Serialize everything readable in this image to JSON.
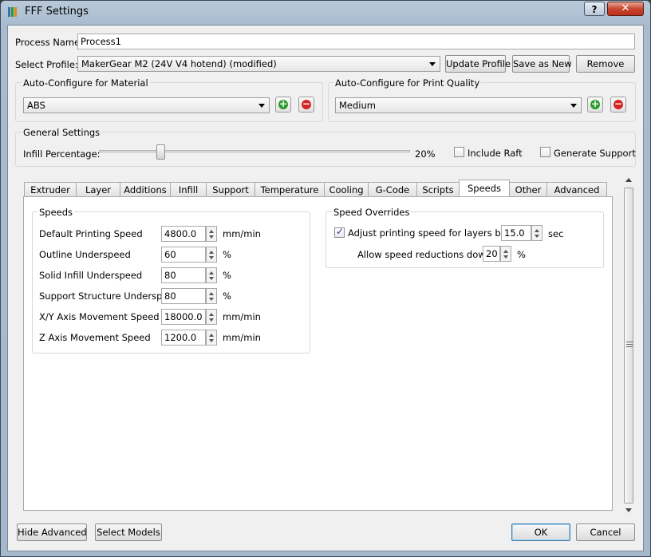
{
  "window": {
    "title": "FFF Settings",
    "help_label": "?",
    "close_label": "✕"
  },
  "process": {
    "label": "Process Name:",
    "value": "Process1"
  },
  "profile": {
    "label": "Select Profile:",
    "selected": "MakerGear M2 (24V V4 hotend) (modified)",
    "update_label": "Update Profile",
    "save_label": "Save as New",
    "remove_label": "Remove"
  },
  "material": {
    "title": "Auto-Configure for Material",
    "selected": "ABS"
  },
  "quality": {
    "title": "Auto-Configure for Print Quality",
    "selected": "Medium"
  },
  "general": {
    "title": "General Settings",
    "infill_label": "Infill Percentage:",
    "infill_value_text": "20%",
    "infill_percent": 20,
    "raft_label": "Include Raft",
    "raft_checked": false,
    "support_label": "Generate Support",
    "support_checked": false
  },
  "tabs": [
    {
      "label": "Extruder"
    },
    {
      "label": "Layer"
    },
    {
      "label": "Additions"
    },
    {
      "label": "Infill"
    },
    {
      "label": "Support"
    },
    {
      "label": "Temperature"
    },
    {
      "label": "Cooling"
    },
    {
      "label": "G-Code"
    },
    {
      "label": "Scripts"
    },
    {
      "label": "Speeds"
    },
    {
      "label": "Other"
    },
    {
      "label": "Advanced"
    }
  ],
  "active_tab": "Speeds",
  "speeds": {
    "title": "Speeds",
    "rows": [
      {
        "label": "Default Printing Speed",
        "value": "4800.0",
        "unit": "mm/min"
      },
      {
        "label": "Outline Underspeed",
        "value": "60",
        "unit": "%"
      },
      {
        "label": "Solid Infill Underspeed",
        "value": "80",
        "unit": "%"
      },
      {
        "label": "Support Structure Underspeed",
        "value": "80",
        "unit": "%"
      },
      {
        "label": "X/Y Axis Movement Speed",
        "value": "18000.0",
        "unit": "mm/min"
      },
      {
        "label": "Z Axis Movement Speed",
        "value": "1200.0",
        "unit": "mm/min"
      }
    ]
  },
  "overrides": {
    "title": "Speed Overrides",
    "adjust_label": "Adjust printing speed for layers below",
    "adjust_checked": true,
    "adjust_value": "15.0",
    "adjust_unit": "sec",
    "allow_label": "Allow speed reductions down to",
    "allow_value": "20",
    "allow_unit": "%"
  },
  "footer": {
    "hide_advanced_label": "Hide Advanced",
    "select_models_label": "Select Models",
    "ok_label": "OK",
    "cancel_label": "Cancel"
  },
  "colors": {
    "add": "#2d9c2d",
    "remove": "#d42424",
    "close": "#c9452f"
  }
}
